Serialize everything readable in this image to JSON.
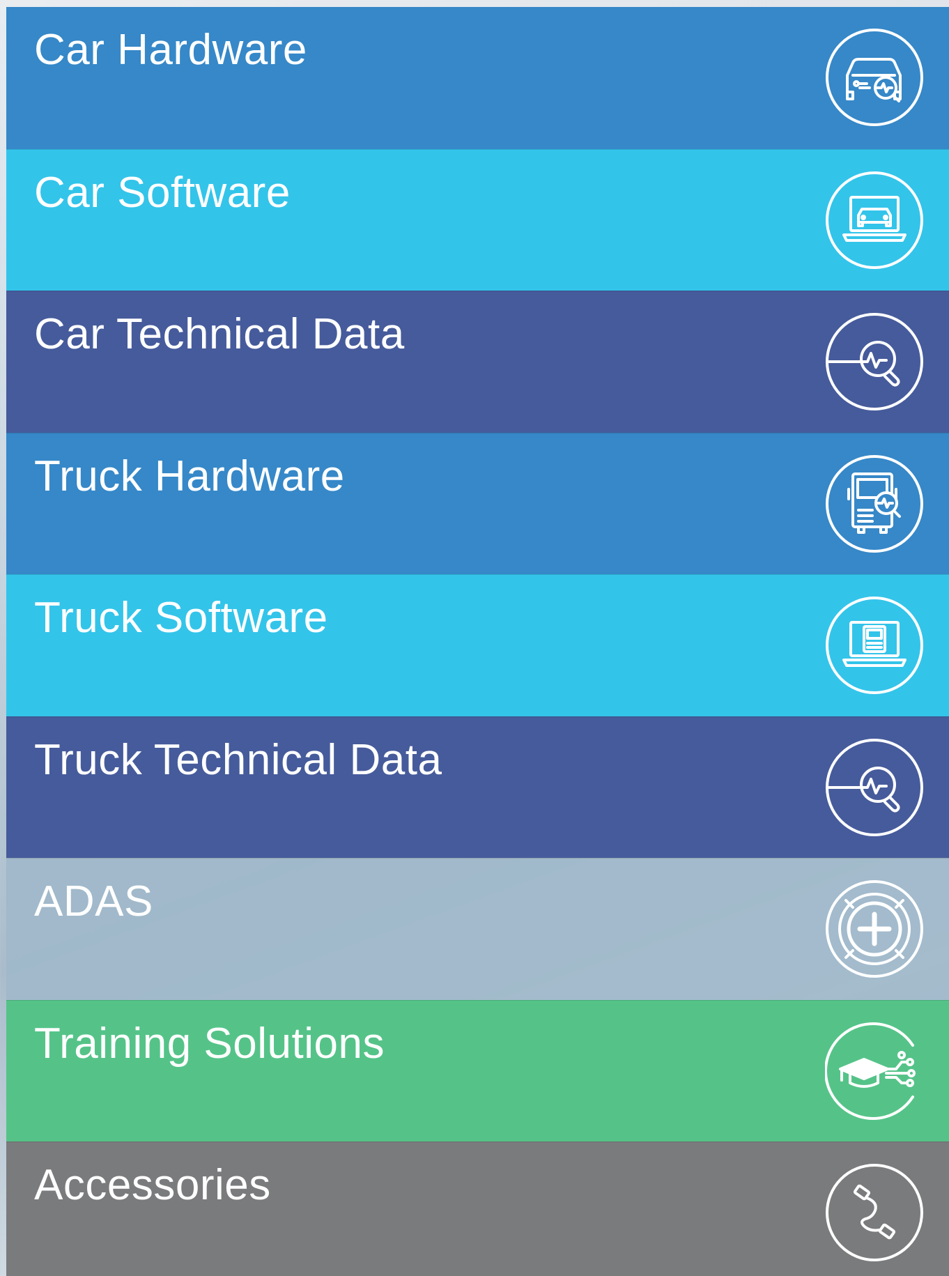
{
  "menu": {
    "items": [
      {
        "label": "Car Hardware",
        "icon": "car-diagnostic-icon",
        "color": "#3688c8"
      },
      {
        "label": "Car Software",
        "icon": "car-laptop-icon",
        "color": "#33c4ea"
      },
      {
        "label": "Car Technical Data",
        "icon": "pulse-search-icon",
        "color": "#465b9b"
      },
      {
        "label": "Truck Hardware",
        "icon": "truck-diagnostic-icon",
        "color": "#3688c8"
      },
      {
        "label": "Truck Software",
        "icon": "truck-laptop-icon",
        "color": "#33c4ea"
      },
      {
        "label": "Truck Technical Data",
        "icon": "pulse-search-icon",
        "color": "#465b9b"
      },
      {
        "label": "ADAS",
        "icon": "target-icon",
        "color": "#a0b9ca"
      },
      {
        "label": "Training Solutions",
        "icon": "graduation-cap-icon",
        "color": "#55c388"
      },
      {
        "label": "Accessories",
        "icon": "cable-icon",
        "color": "#7a7b7d"
      }
    ]
  }
}
